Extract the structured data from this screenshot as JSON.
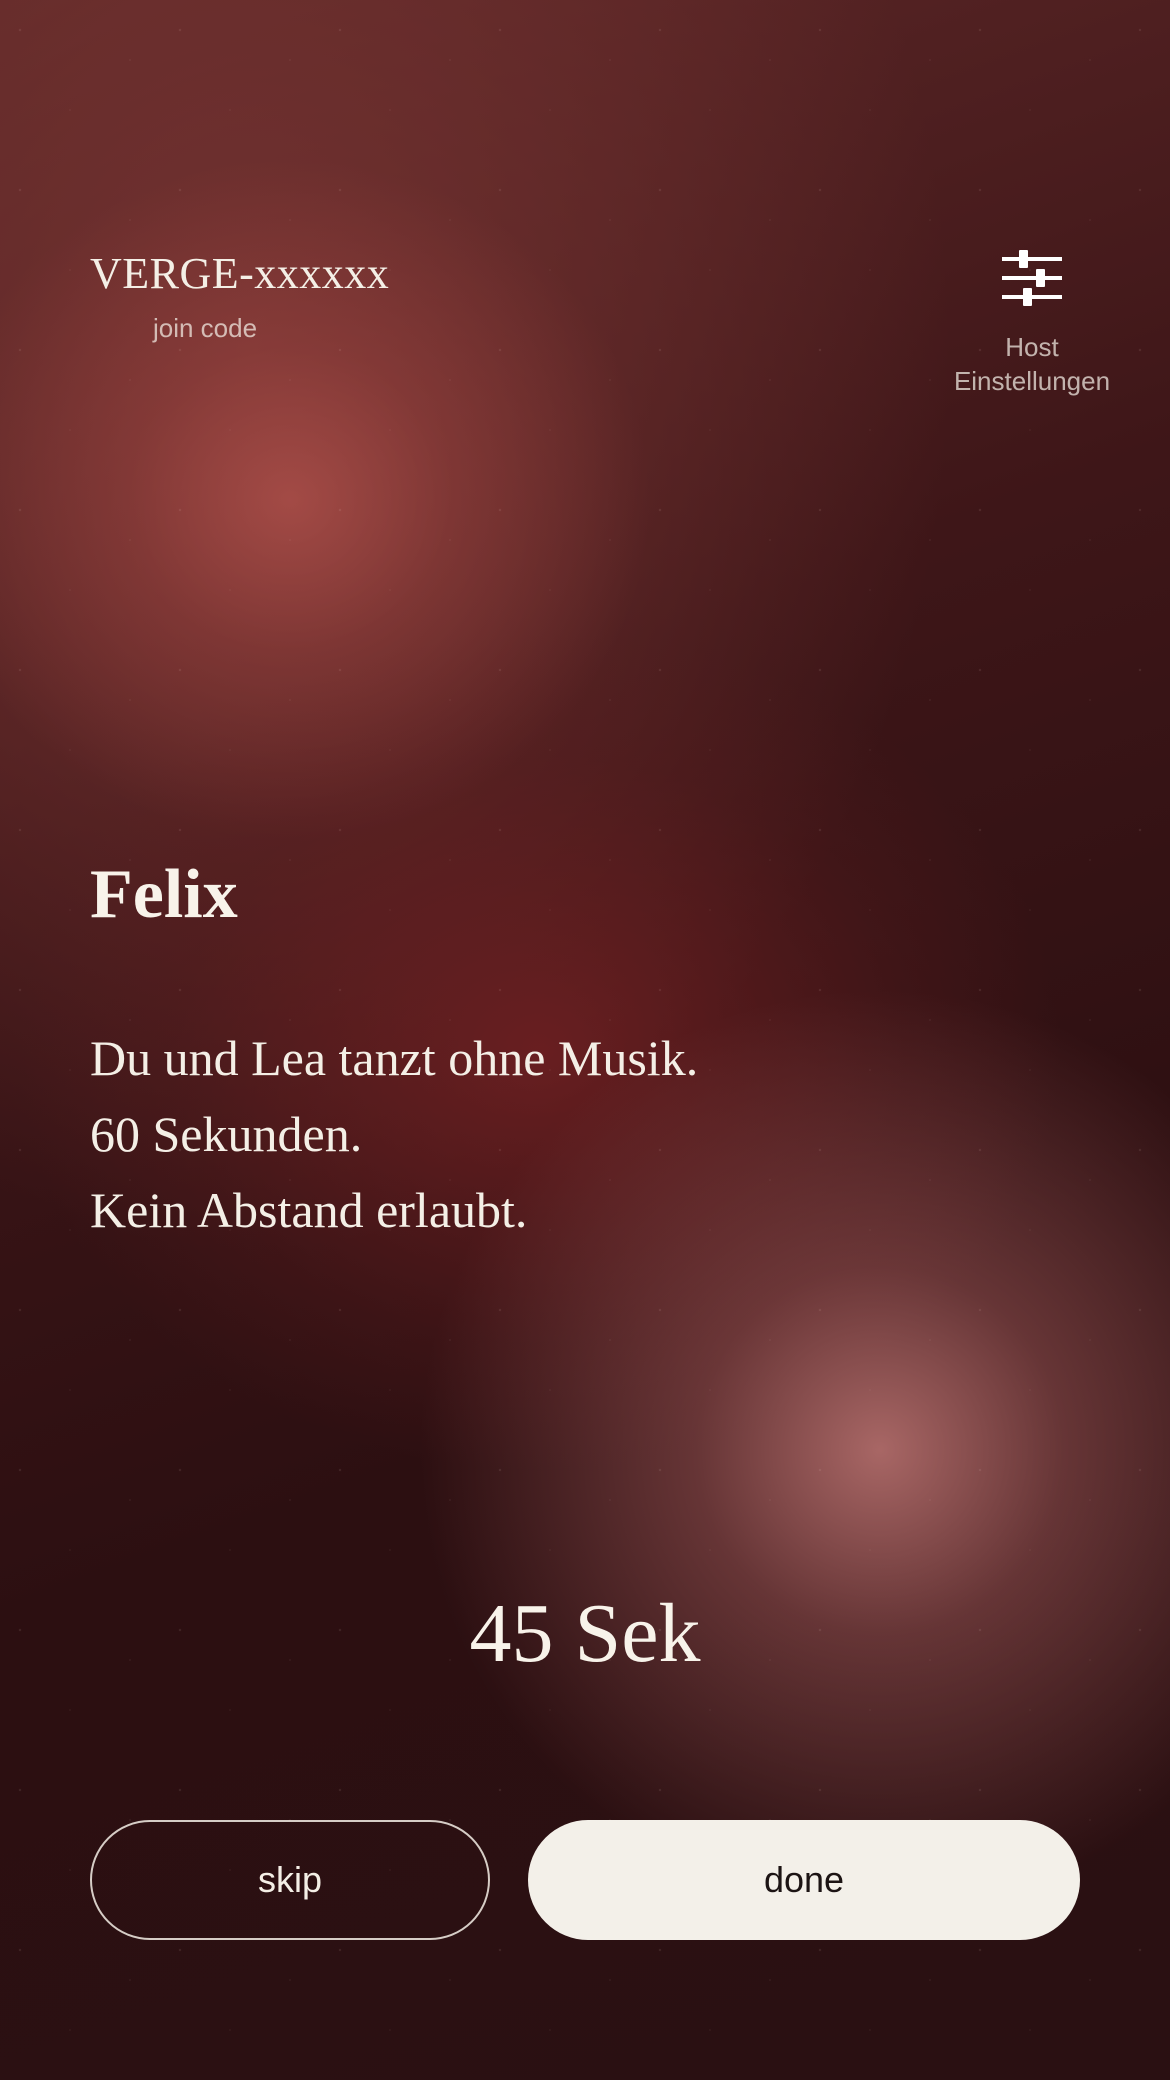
{
  "header": {
    "join_code": "VERGE-xxxxxx",
    "join_label": "join code",
    "settings_icon": "sliders-icon",
    "settings_label_line1": "Host",
    "settings_label_line2": "Einstellungen"
  },
  "card": {
    "player_name": "Felix",
    "prompt_lines": [
      "Du und Lea tanzt ohne Musik.",
      "60 Sekunden.",
      "Kein Abstand erlaubt."
    ]
  },
  "timer": {
    "label": "45 Sek"
  },
  "actions": {
    "skip_label": "skip",
    "done_label": "done"
  },
  "colors": {
    "background_dark": "#2c0f11",
    "glow_top": "#b6544e",
    "glow_bottom": "#be7674",
    "text": "#f4efe6",
    "done_button_bg": "#f3f0e9",
    "done_button_text": "#1c1414"
  }
}
